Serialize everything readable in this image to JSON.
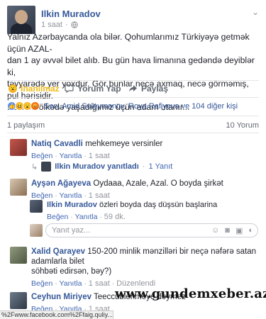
{
  "post": {
    "author": "Ilkin Muradov",
    "time": "1 saat",
    "privacy_icon": "globe-icon",
    "text_lines": [
      "Yalnız Azərbaycanda ola bilər. Qohumlarımız Türkiyəyə getmək üçün AZAL-",
      "dan 1 ay əvvəl bilet alıb. Bu gün hava limanına gedəndə deyiblər ki,",
      "təyyarədə yer yoxdur. Gör bunlar necə axmaq, necə görməmiş, pul hərisidir.",
      "Belə bir ölkədə yaşadığımız üçün adam utanır..."
    ]
  },
  "actions": {
    "react_label": "İnanılmaz",
    "comment_label": "Yorum Yap",
    "share_label": "Paylaş"
  },
  "reactions": {
    "summary": "Sen, Amid Suleymanov, Roya Rafiyeva ve 104 diğer kişi"
  },
  "counts": {
    "shares": "1 paylaşım",
    "comments": "10 Yorum"
  },
  "comments": [
    {
      "author": "Natiq Cavadli",
      "text": "mehkemeye versinler",
      "like": "Beğen",
      "reply": "Yanıtla",
      "time": "1 saat",
      "replied_by": "Ilkin Muradov yanıtladı",
      "reply_count": "1 Yanıt"
    },
    {
      "author": "Ayşən Ağayeva",
      "text": "Oydaaa, Azale, Azal. O boyda şirkət",
      "like": "Beğen",
      "reply": "Yanıtla",
      "time": "1 saat",
      "nested": {
        "author": "Ilkin Muradov",
        "text": "özleri boyda daş düşsün başlarina",
        "like": "Beğen",
        "reply": "Yanıtla",
        "time": "59 dk."
      },
      "write_placeholder": "Yanıt yaz..."
    },
    {
      "author": "Xalid Qarayev",
      "text_lines": [
        "150-200 minlik mənzilləri bir neçə nəfərə satan adamlarla bilet",
        "söhbəti edirsən, bəy?)"
      ],
      "like": "Beğen",
      "reply": "Yanıtla",
      "time": "1 saat",
      "edited": "Düzenlendi"
    },
    {
      "author": "Ceyhun Miriyev",
      "text": "Teeccublenmeye deymez",
      "like": "Beğen",
      "reply": "Yanıtla",
      "time": "1 saat"
    }
  ],
  "watermark": "www.gundemxeber.az",
  "status_url": "%2Fwww.facebook.com%2Ffaig.quliy...",
  "colors": {
    "link": "#365899",
    "muted": "#90949c",
    "action": "#606770"
  }
}
